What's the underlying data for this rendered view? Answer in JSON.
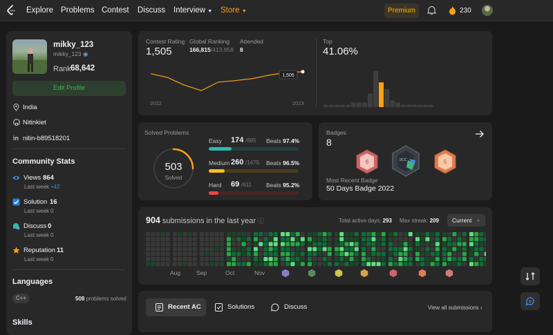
{
  "nav": {
    "items": [
      "Explore",
      "Problems",
      "Contest",
      "Discuss",
      "Interview",
      "Store"
    ],
    "premium": "Premium",
    "streak": "230"
  },
  "profile": {
    "name": "mikky_123",
    "username": "mikky_123",
    "rank_label": "Rank",
    "rank": "68,642",
    "edit_label": "Edit Profile",
    "location": "India",
    "github": "Nitinkiet",
    "linkedin": "nitin-b89518201"
  },
  "community": {
    "title": "Community Stats",
    "stats": [
      {
        "label": "Views",
        "value": "864",
        "sub": "Last week",
        "delta": "+42",
        "delta_color": "#3e8de8",
        "icon": "eye-icon",
        "color": "#3e8de8"
      },
      {
        "label": "Solution",
        "value": "16",
        "sub": "Last week",
        "delta": "0",
        "delta_color": "#9b9b9b",
        "icon": "check-square-icon",
        "color": "#2c7fd9"
      },
      {
        "label": "Discuss",
        "value": "0",
        "sub": "Last week",
        "delta": "0",
        "delta_color": "#9b9b9b",
        "icon": "chat-icon",
        "color": "#2db7a4"
      },
      {
        "label": "Reputation",
        "value": "11",
        "sub": "Last week",
        "delta": "0",
        "delta_color": "#9b9b9b",
        "icon": "star-icon",
        "color": "#ffa116"
      }
    ]
  },
  "languages": {
    "title": "Languages",
    "tag": "C++",
    "solved_count": "508",
    "solved_text": "problems solved"
  },
  "skills": {
    "title": "Skills"
  },
  "contest": {
    "rating_label": "Contest Rating",
    "rating": "1,505",
    "ranking_label": "Global Ranking",
    "ranking": "166,815",
    "ranking_total": "/413,958",
    "attended_label": "Attended",
    "attended": "8",
    "tooltip": "1,505",
    "year_start": "2022",
    "year_end": "2023",
    "top_label": "Top",
    "top_value": "41.06%"
  },
  "chart_data": {
    "type": "line",
    "x": [
      1,
      2,
      3,
      4,
      5,
      6,
      7,
      8,
      9,
      10
    ],
    "values": [
      1500,
      1490,
      1470,
      1456,
      1478,
      1482,
      1487,
      1496,
      1503,
      1505
    ],
    "histogram": [
      1,
      1,
      1,
      1,
      1,
      2,
      2,
      2,
      6,
      16,
      11,
      8,
      3,
      2,
      1,
      1,
      1,
      1,
      1,
      1
    ],
    "highlight_index": 10
  },
  "solved": {
    "title": "Solved Problems",
    "total": "503",
    "total_label": "Solved",
    "rows": [
      {
        "label": "Easy",
        "value": "174",
        "total": "/695",
        "beats_label": "Beats",
        "beats": "97.4%",
        "fraction": 0.25,
        "color": "#2cbbb3",
        "bg": "#21403f"
      },
      {
        "label": "Medium",
        "value": "260",
        "total": "/1475",
        "beats_label": "Beats",
        "beats": "96.5%",
        "fraction": 0.18,
        "color": "#ffc01e",
        "bg": "#4a3d1c"
      },
      {
        "label": "Hard",
        "value": "69",
        "total": "/611",
        "beats_label": "Beats",
        "beats": "95.2%",
        "fraction": 0.11,
        "color": "#ef4743",
        "bg": "#4a2424"
      }
    ]
  },
  "badges": {
    "title": "Badges",
    "count": "8",
    "recent_label": "Most Recent Badge",
    "recent": "50 Days Badge 2022"
  },
  "submissions": {
    "count": "904",
    "text": "submissions in the last year",
    "active_label": "Total active days:",
    "active": "293",
    "streak_label": "Max streak:",
    "streak": "209",
    "select": "Current",
    "months": [
      "Aug",
      "Sep",
      "Oct",
      "Nov"
    ]
  },
  "recent": {
    "tabs": [
      "Recent AC",
      "Solutions",
      "Discuss"
    ],
    "view_all": "View all submissions"
  }
}
